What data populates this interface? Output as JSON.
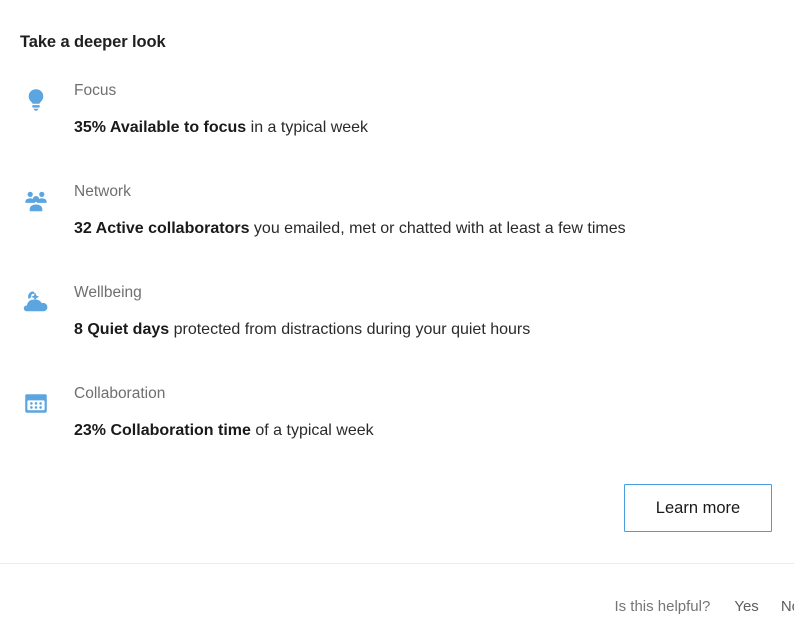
{
  "card": {
    "title": "Take a deeper look",
    "accent_color": "#5ba5e0",
    "title_color": "#201f1e",
    "label_color": "#706f6e",
    "divider_color": "#ebebeb"
  },
  "insights": [
    {
      "icon": "lightbulb-icon",
      "label": "Focus",
      "stat_value": "35% Available to focus",
      "stat_rest": " in a typical week"
    },
    {
      "icon": "people-group-icon",
      "label": "Network",
      "stat_value": "32 Active collaborators",
      "stat_rest": " you emailed, met or chatted with at least a few times"
    },
    {
      "icon": "moon-cloud-icon",
      "label": "Wellbeing",
      "stat_value": "8 Quiet days",
      "stat_rest": " protected from distractions during your quiet hours"
    },
    {
      "icon": "calendar-icon",
      "label": "Collaboration",
      "stat_value": "23% Collaboration time",
      "stat_rest": " of a typical week"
    }
  ],
  "actions": {
    "learn_more_label": "Learn more",
    "learn_more_border_color": "#4a9fe0"
  },
  "footer": {
    "question": "Is this helpful?",
    "yes_label": "Yes",
    "no_label": "No"
  }
}
